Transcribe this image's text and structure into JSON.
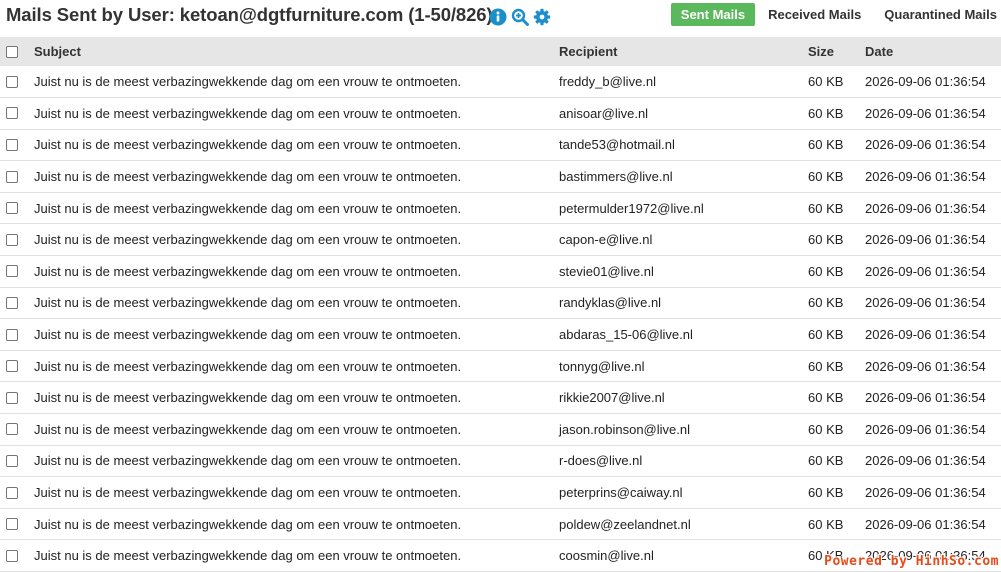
{
  "header": {
    "title": "Mails Sent by User: ketoan@dgtfurniture.com (1-50/826)",
    "icons": [
      "info-icon",
      "zoom-icon",
      "gear-icon"
    ],
    "tabs": {
      "sent": "Sent Mails",
      "received": "Received Mails",
      "quarantined": "Quarantined Mails"
    },
    "active_tab_color": "#5cb85c",
    "icon_color": "#1a8fc9"
  },
  "table": {
    "columns": {
      "subject": "Subject",
      "recipient": "Recipient",
      "size": "Size",
      "date": "Date"
    },
    "rows": [
      {
        "subject": "Juist nu is de meest verbazingwekkende dag om een vrouw te ontmoeten.",
        "recipient": "freddy_b@live.nl",
        "size": "60 KB",
        "date": "2026-09-06 01:36:54"
      },
      {
        "subject": "Juist nu is de meest verbazingwekkende dag om een vrouw te ontmoeten.",
        "recipient": "anisoar@live.nl",
        "size": "60 KB",
        "date": "2026-09-06 01:36:54"
      },
      {
        "subject": "Juist nu is de meest verbazingwekkende dag om een vrouw te ontmoeten.",
        "recipient": "tande53@hotmail.nl",
        "size": "60 KB",
        "date": "2026-09-06 01:36:54"
      },
      {
        "subject": "Juist nu is de meest verbazingwekkende dag om een vrouw te ontmoeten.",
        "recipient": "bastimmers@live.nl",
        "size": "60 KB",
        "date": "2026-09-06 01:36:54"
      },
      {
        "subject": "Juist nu is de meest verbazingwekkende dag om een vrouw te ontmoeten.",
        "recipient": "petermulder1972@live.nl",
        "size": "60 KB",
        "date": "2026-09-06 01:36:54"
      },
      {
        "subject": "Juist nu is de meest verbazingwekkende dag om een vrouw te ontmoeten.",
        "recipient": "capon-e@live.nl",
        "size": "60 KB",
        "date": "2026-09-06 01:36:54"
      },
      {
        "subject": "Juist nu is de meest verbazingwekkende dag om een vrouw te ontmoeten.",
        "recipient": "stevie01@live.nl",
        "size": "60 KB",
        "date": "2026-09-06 01:36:54"
      },
      {
        "subject": "Juist nu is de meest verbazingwekkende dag om een vrouw te ontmoeten.",
        "recipient": "randyklas@live.nl",
        "size": "60 KB",
        "date": "2026-09-06 01:36:54"
      },
      {
        "subject": "Juist nu is de meest verbazingwekkende dag om een vrouw te ontmoeten.",
        "recipient": "abdaras_15-06@live.nl",
        "size": "60 KB",
        "date": "2026-09-06 01:36:54"
      },
      {
        "subject": "Juist nu is de meest verbazingwekkende dag om een vrouw te ontmoeten.",
        "recipient": "tonnyg@live.nl",
        "size": "60 KB",
        "date": "2026-09-06 01:36:54"
      },
      {
        "subject": "Juist nu is de meest verbazingwekkende dag om een vrouw te ontmoeten.",
        "recipient": "rikkie2007@live.nl",
        "size": "60 KB",
        "date": "2026-09-06 01:36:54"
      },
      {
        "subject": "Juist nu is de meest verbazingwekkende dag om een vrouw te ontmoeten.",
        "recipient": "jason.robinson@live.nl",
        "size": "60 KB",
        "date": "2026-09-06 01:36:54"
      },
      {
        "subject": "Juist nu is de meest verbazingwekkende dag om een vrouw te ontmoeten.",
        "recipient": "r-does@live.nl",
        "size": "60 KB",
        "date": "2026-09-06 01:36:54"
      },
      {
        "subject": "Juist nu is de meest verbazingwekkende dag om een vrouw te ontmoeten.",
        "recipient": "peterprins@caiway.nl",
        "size": "60 KB",
        "date": "2026-09-06 01:36:54"
      },
      {
        "subject": "Juist nu is de meest verbazingwekkende dag om een vrouw te ontmoeten.",
        "recipient": "poldew@zeelandnet.nl",
        "size": "60 KB",
        "date": "2026-09-06 01:36:54"
      },
      {
        "subject": "Juist nu is de meest verbazingwekkende dag om een vrouw te ontmoeten.",
        "recipient": "coosmin@live.nl",
        "size": "60 KB",
        "date": "2026-09-06 01:36:54"
      }
    ]
  },
  "watermark": "Powered by HinhSo.com"
}
